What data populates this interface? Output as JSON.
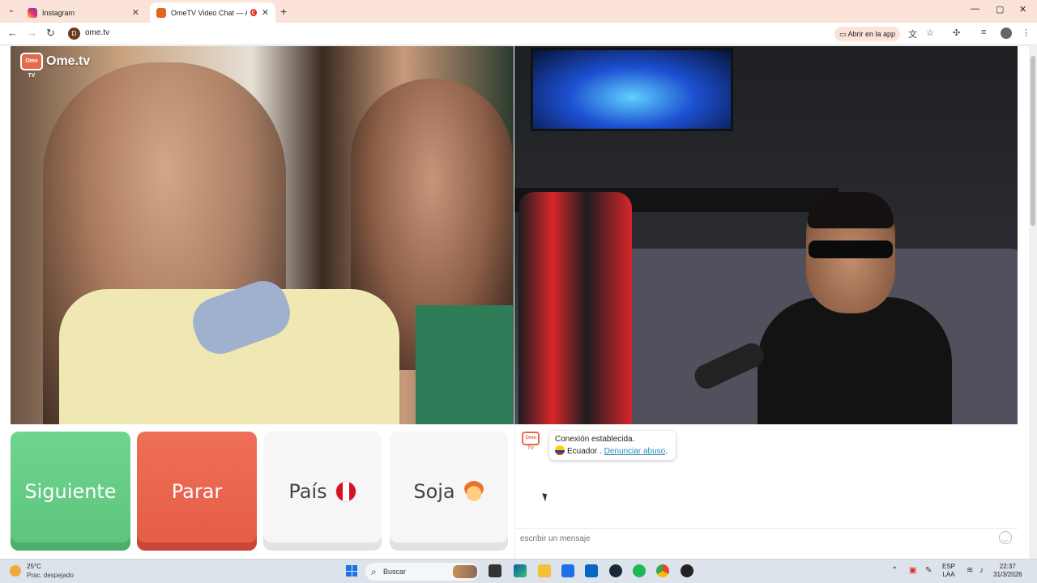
{
  "tabs": [
    {
      "title": "Instagram",
      "close": "✕"
    },
    {
      "title": "OmeTV Video Chat — Alter",
      "close": "✕"
    }
  ],
  "browser": {
    "new_tab": "+",
    "url": "ome.tv",
    "site_icon_text": "D",
    "open_in_app": "Abrir en la app",
    "window_controls": [
      "—",
      "▢",
      "✕"
    ]
  },
  "video": {
    "logo_box": "Ome TV",
    "logo_text": "Ome.tv"
  },
  "buttons": {
    "next": "Siguiente",
    "stop": "Parar",
    "country": "País",
    "gender": "Soja"
  },
  "chat": {
    "logo_text": "Ome TV",
    "connected": "Conexión establecida.",
    "country": "Ecuador",
    "separator": " . ",
    "report": "Denunciar abuso",
    "period": ".",
    "input_placeholder": "escribir un mensaje"
  },
  "taskbar": {
    "temperature": "25°C",
    "weather": "Prac. despejado",
    "search": "Buscar",
    "lang_top": "ESP",
    "lang_bottom": "LAA",
    "time": "22:37",
    "date": "31/3/2026"
  },
  "colors": {
    "next": "#5cc47d",
    "stop": "#e45c45",
    "brand": "#e46a4b",
    "tab_strip": "#fbe3da"
  }
}
